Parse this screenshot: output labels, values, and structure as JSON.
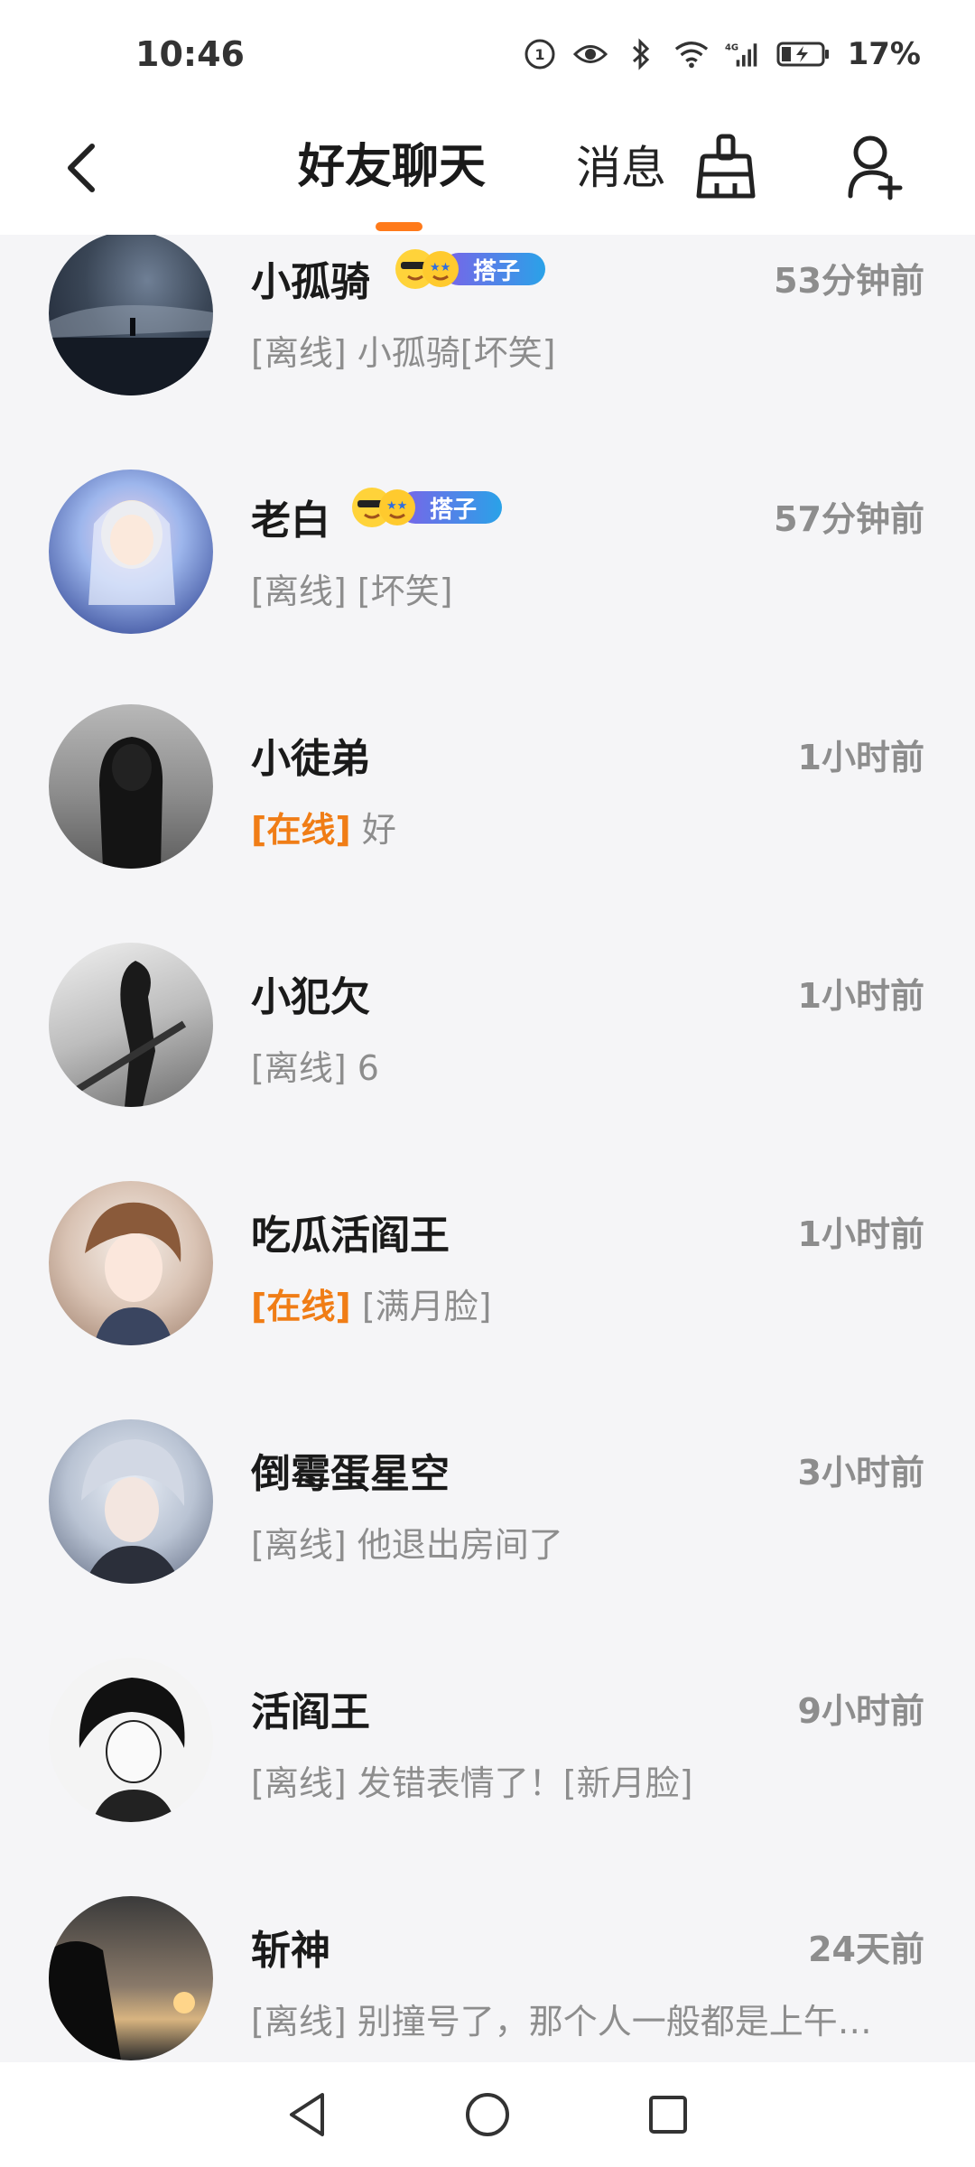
{
  "status_bar": {
    "time": "10:46",
    "battery": "17%",
    "icons": [
      "hd-icon",
      "eye-icon",
      "bluetooth-icon",
      "wifi-icon",
      "signal-4g-icon",
      "battery-charging-icon"
    ]
  },
  "header": {
    "tab_friends": "好友聊天",
    "tab_messages": "消息",
    "accent_color": "#ff7a1a"
  },
  "chats": [
    {
      "name": "小孤骑",
      "time": "53分钟前",
      "status": "[离线]",
      "message": "小孤骑[坏笑]",
      "badge": "搭子",
      "avatar": "night-sky-avatar"
    },
    {
      "name": "老白",
      "time": "57分钟前",
      "status": "[离线]",
      "message": "[坏笑]",
      "badge": "搭子",
      "avatar": "anime-girl-avatar"
    },
    {
      "name": "小徒弟",
      "time": "1小时前",
      "status": "[在线]",
      "message": "好",
      "badge": "",
      "avatar": "hooded-figure-avatar"
    },
    {
      "name": "小犯欠",
      "time": "1小时前",
      "status": "[离线]",
      "message": "6",
      "badge": "",
      "avatar": "swordsman-avatar"
    },
    {
      "name": "吃瓜活阎王",
      "time": "1小时前",
      "status": "[在线]",
      "message": "[满月脸]",
      "badge": "",
      "avatar": "anime-boy-avatar"
    },
    {
      "name": "倒霉蛋星空",
      "time": "3小时前",
      "status": "[离线]",
      "message": "他退出房间了",
      "badge": "",
      "avatar": "silver-hair-avatar"
    },
    {
      "name": "活阎王",
      "time": "9小时前",
      "status": "[离线]",
      "message": "发错表情了！[新月脸]",
      "badge": "",
      "avatar": "manga-boy-avatar"
    },
    {
      "name": "斩神",
      "time": "24天前",
      "status": "[离线]",
      "message": "别撞号了，那个人一般都是上午…",
      "badge": "",
      "avatar": "sunset-silhouette-avatar"
    }
  ]
}
